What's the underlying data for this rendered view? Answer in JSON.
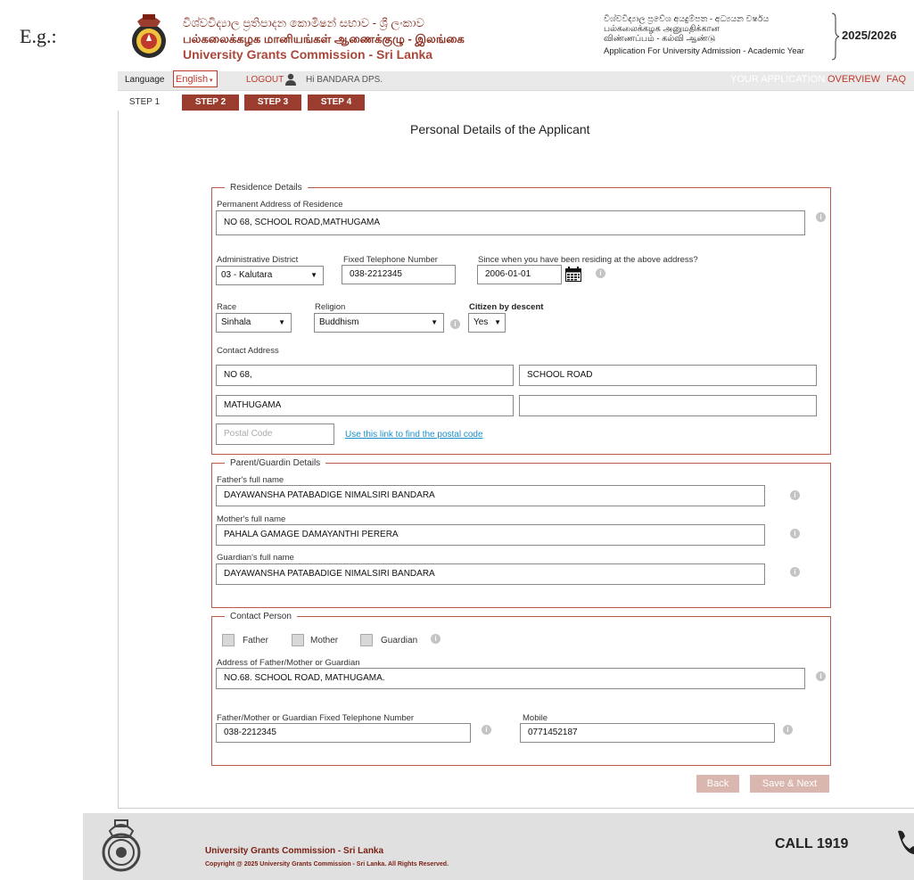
{
  "example_label": "E.g.:",
  "header": {
    "title_sinhala": "විශ්වවිද්‍යාල ප්‍රතිපාදන කොමිෂන් සභාව - ශ්‍රී ලංකාව",
    "title_tamil": "பல்கலைக்கழக மானியங்கள் ஆணைக்குழு - இலங்கை",
    "title_english": "University Grants Commission - Sri Lanka",
    "subtitle_sinhala": "විශ්වවිද්‍යාල ප්‍රවේශ අයදුම්පත - අධ්‍යයන වර්ෂය",
    "subtitle_tamil_1": "பல்கலைக்கழக அனுமதிக்கான",
    "subtitle_tamil_2": "விண்ணப்பம் - கல்வி ஆண்டு",
    "subtitle_english": "Application For University Admission - Academic Year",
    "year": "2025/2026"
  },
  "navbar": {
    "language_label": "Language",
    "language_value": "English",
    "logout": "LOGOUT",
    "greeting": "Hi BANDARA DPS.",
    "your_application": "YOUR APPLICATION",
    "overview": "OVERVIEW",
    "faq": "FAQ"
  },
  "steps": [
    "STEP 1",
    "STEP 2",
    "STEP 3",
    "STEP 4"
  ],
  "page_title": "Personal Details of the Applicant",
  "residence": {
    "legend": "Residence Details",
    "permanent_address_label": "Permanent Address of Residence",
    "permanent_address": "NO 68, SCHOOL ROAD,MATHUGAMA",
    "district_label": "Administrative District",
    "district": "03 - Kalutara",
    "telephone_label": "Fixed Telephone Number",
    "telephone": "038-2212345",
    "since_label": "Since when you have been residing at the above address?",
    "since": "2006-01-01",
    "race_label": "Race",
    "race": "Sinhala",
    "religion_label": "Religion",
    "religion": "Buddhism",
    "citizen_label": "Citizen by descent",
    "citizen": "Yes",
    "contact_address_label": "Contact Address",
    "contact_line1": "NO 68,",
    "contact_line2": "SCHOOL ROAD",
    "contact_line3": "MATHUGAMA",
    "contact_line4": "",
    "postal_placeholder": "Postal Code",
    "postal_link": "Use this link to find the postal code"
  },
  "guardian": {
    "legend": "Parent/Guardin Details",
    "father_label": "Father's full name",
    "father": "DAYAWANSHA PATABADIGE NIMALSIRI BANDARA",
    "mother_label": "Mother's full name",
    "mother": "PAHALA GAMAGE DAMAYANTHI PERERA",
    "guardian_label": "Guardian's full name",
    "guardian": "DAYAWANSHA PATABADIGE NIMALSIRI BANDARA"
  },
  "contact_person": {
    "legend": "Contact Person",
    "opt_father": "Father",
    "opt_mother": "Mother",
    "opt_guardian": "Guardian",
    "address_label": "Address of Father/Mother or Guardian",
    "address": "NO.68. SCHOOL ROAD, MATHUGAMA.",
    "phone_label": "Father/Mother or Guardian Fixed Telephone Number",
    "phone": "038-2212345",
    "mobile_label": "Mobile",
    "mobile": "0771452187"
  },
  "buttons": {
    "back": "Back",
    "save_next": "Save & Next"
  },
  "footer": {
    "title": "University Grants Commission - Sri Lanka",
    "copyright": "Copyright @ 2025 University Grants Commission - Sri Lanka. All Rights Reserved.",
    "call": "CALL 1919"
  },
  "colors": {
    "brand": "#9b3d2e",
    "border": "#b85b4b",
    "link": "#1a8fc9",
    "info": "#c4c4c4"
  }
}
